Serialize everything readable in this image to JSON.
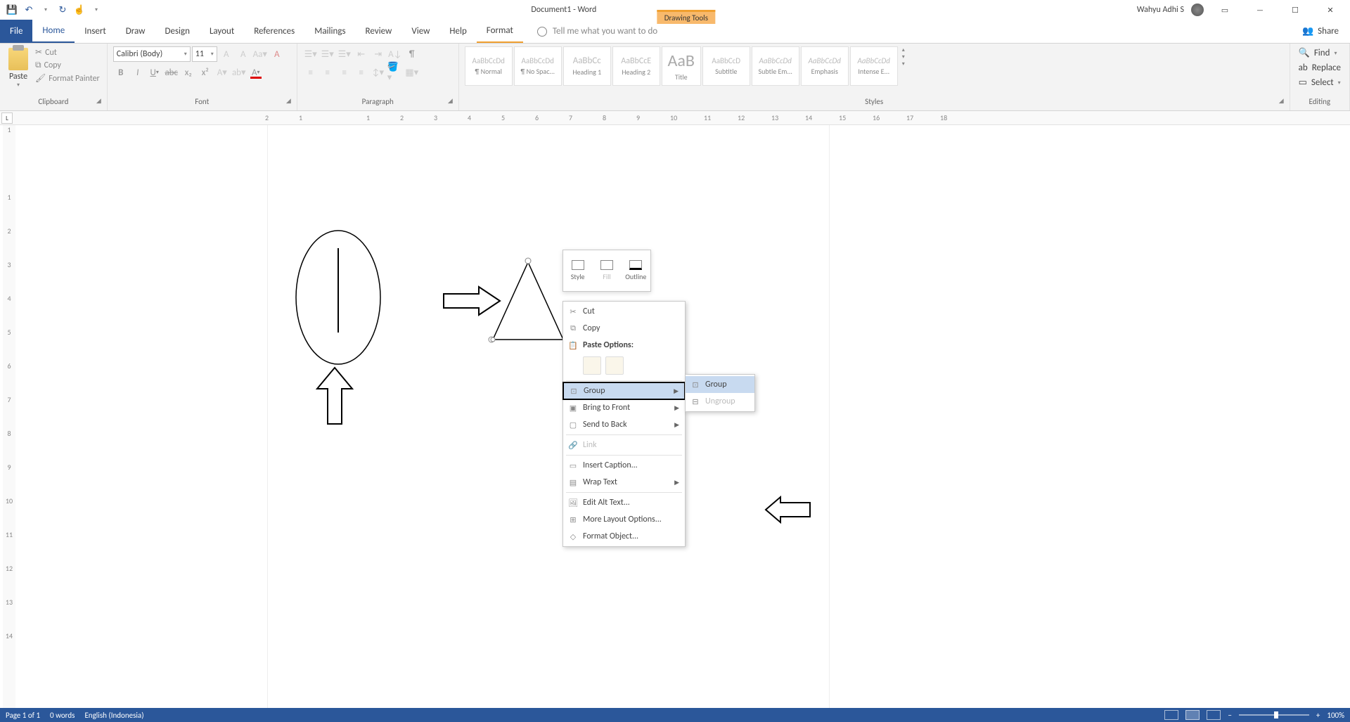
{
  "titlebar": {
    "doc_title": "Document1 - Word",
    "tools_tab": "Drawing Tools",
    "user": "Wahyu Adhi S"
  },
  "tabs": {
    "file": "File",
    "home": "Home",
    "insert": "Insert",
    "draw": "Draw",
    "design": "Design",
    "layout": "Layout",
    "references": "References",
    "mailings": "Mailings",
    "review": "Review",
    "view": "View",
    "help": "Help",
    "format": "Format",
    "tell_me": "Tell me what you want to do",
    "share": "Share"
  },
  "ribbon": {
    "clipboard": {
      "label": "Clipboard",
      "paste": "Paste",
      "cut": "Cut",
      "copy": "Copy",
      "format_painter": "Format Painter"
    },
    "font": {
      "label": "Font",
      "name": "Calibri (Body)",
      "size": "11"
    },
    "paragraph": {
      "label": "Paragraph"
    },
    "styles": {
      "label": "Styles",
      "items": [
        {
          "preview": "AaBbCcDd",
          "name": "¶ Normal"
        },
        {
          "preview": "AaBbCcDd",
          "name": "¶ No Spac..."
        },
        {
          "preview": "AaBbCc",
          "name": "Heading 1"
        },
        {
          "preview": "AaBbCcE",
          "name": "Heading 2"
        },
        {
          "preview": "AaB",
          "name": "Title"
        },
        {
          "preview": "AaBbCcD",
          "name": "Subtitle"
        },
        {
          "preview": "AaBbCcDd",
          "name": "Subtle Em..."
        },
        {
          "preview": "AaBbCcDd",
          "name": "Emphasis"
        },
        {
          "preview": "AaBbCcDd",
          "name": "Intense E..."
        }
      ]
    },
    "editing": {
      "label": "Editing",
      "find": "Find",
      "replace": "Replace",
      "select": "Select"
    }
  },
  "ruler": {
    "h": [
      "2",
      "1",
      "",
      "1",
      "2",
      "3",
      "4",
      "5",
      "6",
      "7",
      "8",
      "9",
      "10",
      "11",
      "12",
      "13",
      "14",
      "15",
      "16",
      "17",
      "18"
    ],
    "v": [
      "1",
      "",
      "1",
      "2",
      "3",
      "4",
      "5",
      "6",
      "7",
      "8",
      "9",
      "10",
      "11",
      "12",
      "13",
      "14"
    ]
  },
  "mini_toolbar": {
    "style": "Style",
    "fill": "Fill",
    "outline": "Outline"
  },
  "context": {
    "cut": "Cut",
    "copy": "Copy",
    "paste_options": "Paste Options:",
    "group": "Group",
    "bring_front": "Bring to Front",
    "send_back": "Send to Back",
    "link": "Link",
    "insert_caption": "Insert Caption...",
    "wrap_text": "Wrap Text",
    "edit_alt": "Edit Alt Text...",
    "more_layout": "More Layout Options...",
    "format_object": "Format Object..."
  },
  "submenu": {
    "group": "Group",
    "ungroup": "Ungroup"
  },
  "statusbar": {
    "page": "Page 1 of 1",
    "words": "0 words",
    "lang": "English (Indonesia)",
    "zoom": "100%"
  }
}
